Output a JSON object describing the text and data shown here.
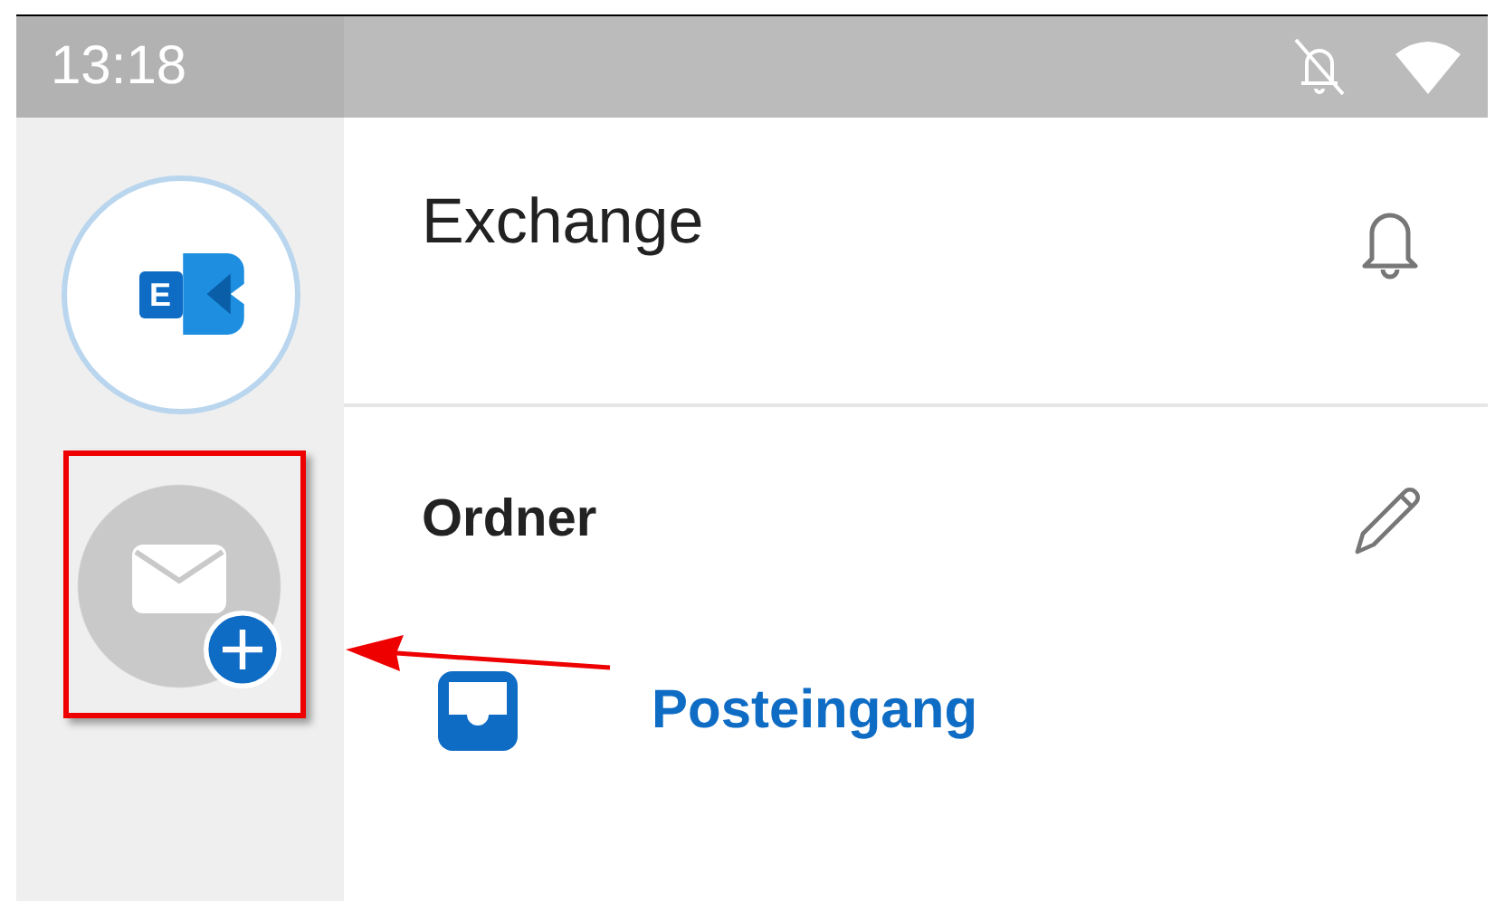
{
  "status_bar": {
    "time": "13:18"
  },
  "sidebar": {
    "accounts": [
      {
        "kind": "exchange",
        "letter": "E"
      },
      {
        "kind": "add"
      }
    ]
  },
  "account_header": {
    "title": "Exchange"
  },
  "folders": {
    "title": "Ordner",
    "items": [
      {
        "label": "Posteingang",
        "kind": "inbox"
      }
    ]
  }
}
